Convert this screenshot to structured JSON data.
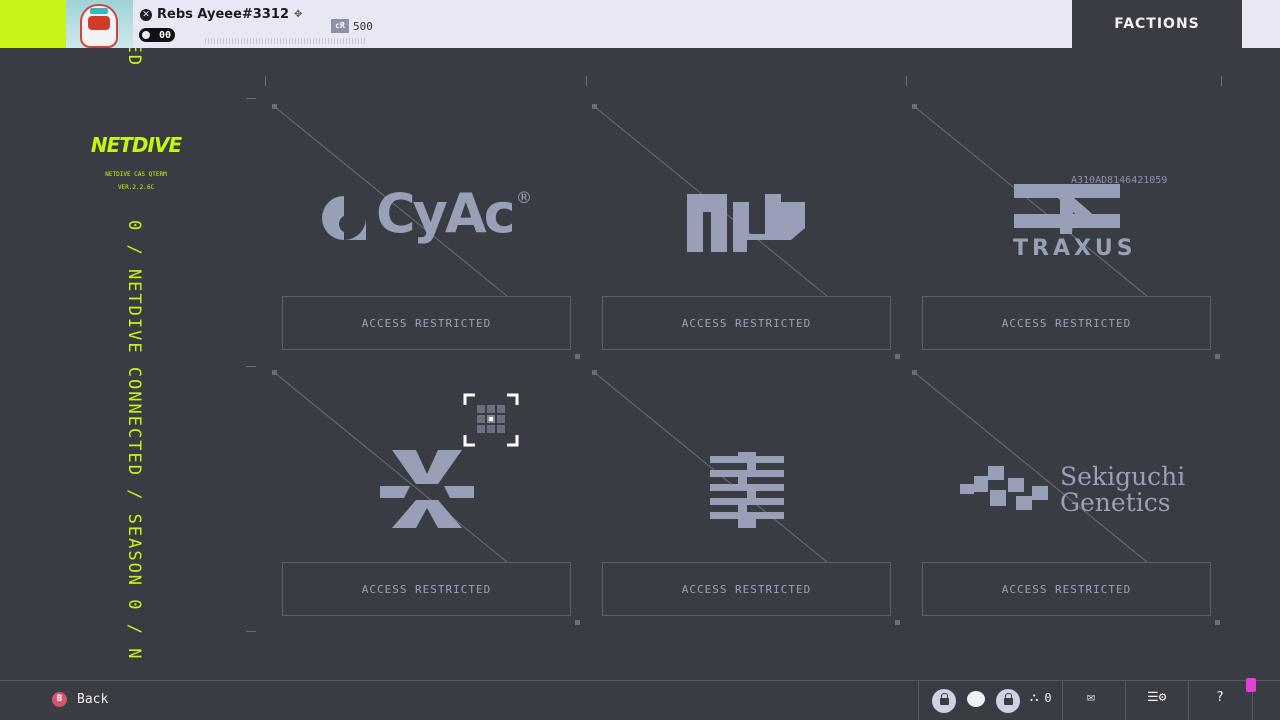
{
  "header": {
    "player_name": "Rebs Ayeee#3312",
    "level": "00",
    "credits_icon": "cR",
    "credits": "500",
    "active_tab": "FACTIONS"
  },
  "sidebar": {
    "vertical_top": "CTED",
    "vertical_status": "0 / NETDIVE CONNECTED / SEASON 0 / N",
    "logo_text": "NETDIVE",
    "logo_sub_1": "NETDIVE CAS QTERM",
    "logo_sub_2": "VER.2.2.6C"
  },
  "factions": [
    {
      "name": "CyAc",
      "mark": "®",
      "status": "ACCESS RESTRICTED"
    },
    {
      "name": "NuCaloric",
      "status": "ACCESS RESTRICTED"
    },
    {
      "name": "TRAXUS",
      "status": "ACCESS RESTRICTED"
    },
    {
      "name": "Arachne",
      "status": "ACCESS RESTRICTED"
    },
    {
      "name": "MIDA",
      "status": "ACCESS RESTRICTED"
    },
    {
      "name_line1": "Sekiguchi",
      "name_line2": "Genetics",
      "status": "ACCESS RESTRICTED"
    }
  ],
  "code_label": "A310AD8146421059",
  "footer": {
    "back_icon": "B",
    "back_label": "Back",
    "party_count": "0",
    "help_label": "?"
  },
  "colors": {
    "accent": "#c6f416",
    "background": "#3a3c44",
    "logo": "#9a9fb8",
    "pink": "#e43fd8"
  }
}
